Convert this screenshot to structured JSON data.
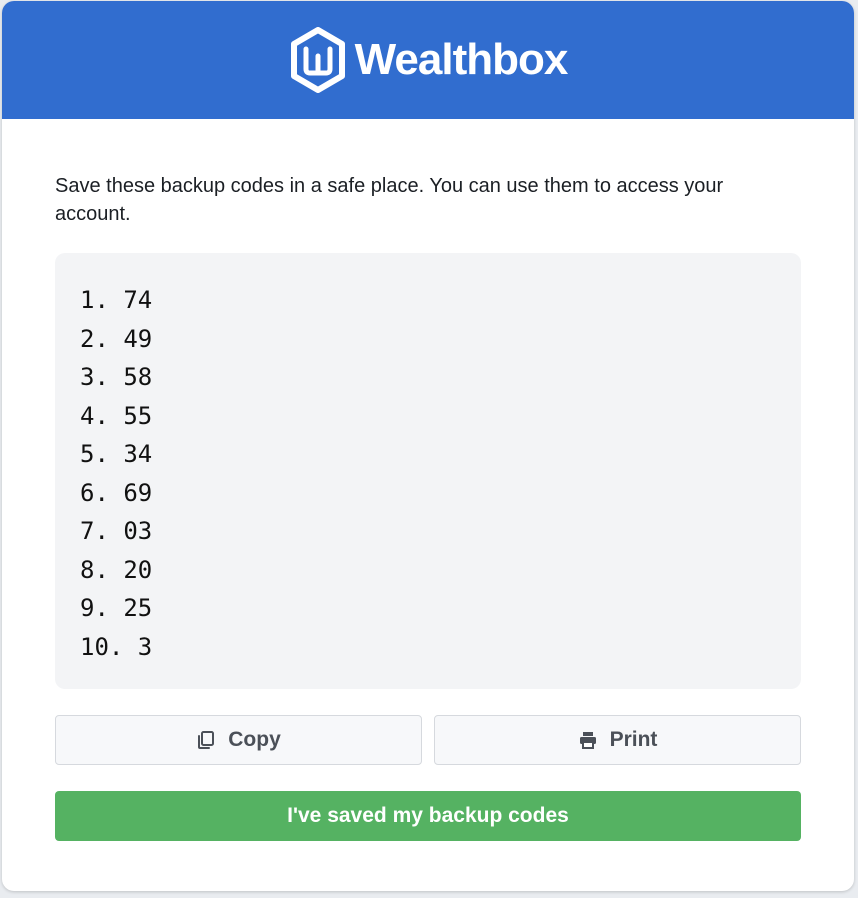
{
  "header": {
    "brand_name": "Wealthbox",
    "logo_icon": "wealthbox-hexagon-w-logo",
    "background_color": "#316dcf"
  },
  "intro_text": "Save these backup codes in a safe place. You can use them to access your account.",
  "backup_codes": [
    "1. 74",
    "2. 49",
    "3. 58",
    "4. 55",
    "5. 34",
    "6. 69",
    "7. 03",
    "8. 20",
    "9. 25",
    "10. 3"
  ],
  "actions": {
    "copy": {
      "label": "Copy",
      "icon": "copy-icon"
    },
    "print": {
      "label": "Print",
      "icon": "printer-icon"
    },
    "confirm": {
      "label": "I've saved my backup codes",
      "color": "#55b262"
    }
  }
}
